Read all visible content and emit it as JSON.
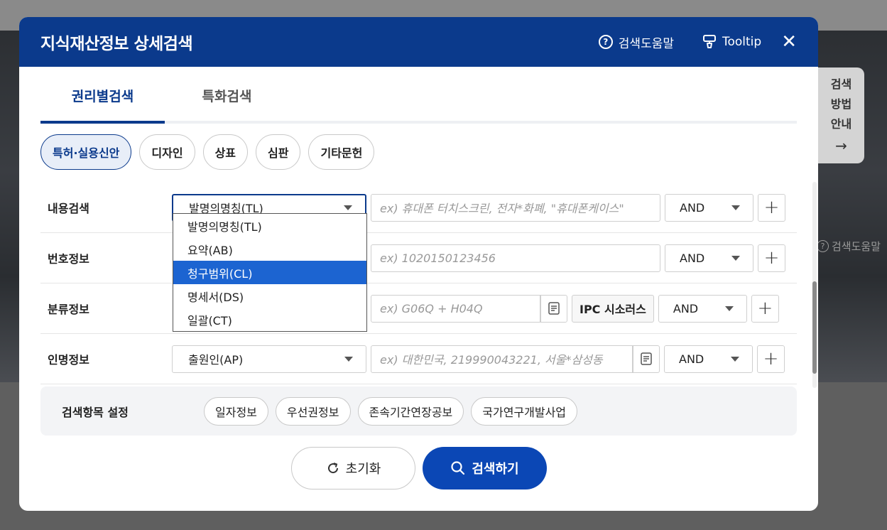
{
  "background": {
    "help_label": "검색도움말"
  },
  "side_guide": {
    "line1": "검색",
    "line2": "방법",
    "line3": "안내",
    "arrow": "→"
  },
  "modal": {
    "title": "지식재산정보 상세검색",
    "help_label": "검색도움말",
    "tooltip_label": "Tooltip",
    "close_label": "✕"
  },
  "tabs": [
    {
      "label": "권리별검색",
      "active": true
    },
    {
      "label": "특화검색",
      "active": false
    }
  ],
  "categories": [
    {
      "label": "특허·실용신안",
      "active": true
    },
    {
      "label": "디자인",
      "active": false
    },
    {
      "label": "상표",
      "active": false
    },
    {
      "label": "심판",
      "active": false
    },
    {
      "label": "기타문헌",
      "active": false
    }
  ],
  "rows": {
    "content": {
      "label": "내용검색",
      "select": "발명의명칭(TL)",
      "placeholder": "ex) 휴대폰 터치스크린, 전자*화폐, \"휴대폰케이스\"",
      "operator": "AND"
    },
    "number": {
      "label": "번호정보",
      "placeholder": "ex) 1020150123456",
      "operator": "AND"
    },
    "classification": {
      "label": "분류정보",
      "placeholder": "ex) G06Q + H04Q",
      "ipc_button": "IPC 시소러스",
      "operator": "AND"
    },
    "person": {
      "label": "인명정보",
      "select": "출원인(AP)",
      "placeholder": "ex) 대한민국, 219990043221, 서울*삼성동",
      "operator": "AND"
    }
  },
  "dropdown": {
    "options": [
      "발명의명칭(TL)",
      "요약(AB)",
      "청구범위(CL)",
      "명세서(DS)",
      "일괄(CT)"
    ],
    "highlighted": "청구범위(CL)"
  },
  "settings": {
    "label": "검색항목 설정",
    "items": [
      "일자정보",
      "우선권정보",
      "존속기간연장공보",
      "국가연구개발사업"
    ]
  },
  "actions": {
    "reset_label": "초기화",
    "search_label": "검색하기"
  },
  "colors": {
    "primary": "#0b3a8c",
    "search_button": "#0b47b5",
    "dropdown_highlight": "#1c64d1"
  }
}
